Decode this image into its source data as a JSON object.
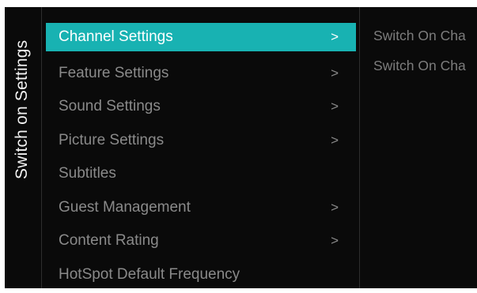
{
  "panel": {
    "title": "Switch on Settings"
  },
  "menu": {
    "items": [
      {
        "label": "Channel Settings",
        "chevron": ">"
      },
      {
        "label": "Feature Settings",
        "chevron": ">"
      },
      {
        "label": "Sound Settings",
        "chevron": ">"
      },
      {
        "label": "Picture Settings",
        "chevron": ">"
      },
      {
        "label": "Subtitles",
        "chevron": ""
      },
      {
        "label": "Guest Management",
        "chevron": ">"
      },
      {
        "label": "Content Rating",
        "chevron": ">"
      },
      {
        "label": "HotSpot Default Frequency",
        "chevron": ""
      }
    ],
    "selected_index": 0
  },
  "submenu": {
    "items": [
      {
        "label": "Switch On Cha"
      },
      {
        "label": "Switch On Cha"
      }
    ]
  },
  "colors": {
    "accent": "#18b2b2",
    "background": "#0a0a0a",
    "text_dim": "#8a8a8a"
  }
}
